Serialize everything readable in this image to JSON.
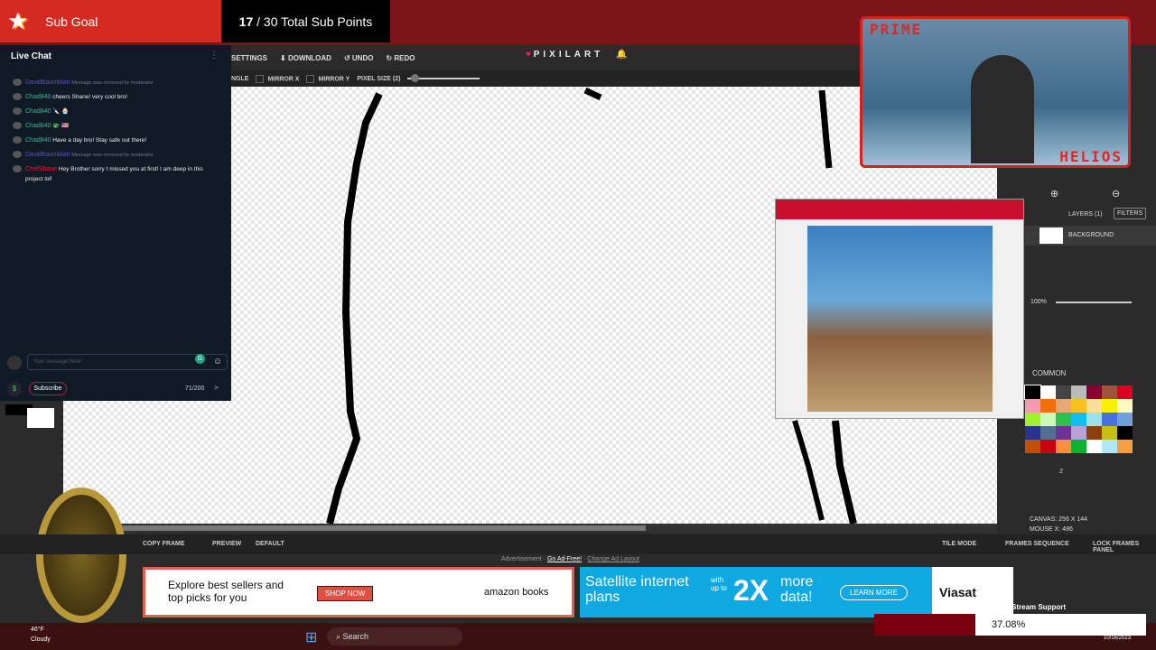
{
  "sub_goal": {
    "label": "Sub Goal",
    "current": "17",
    "total_text": "/ 30 Total Sub Points"
  },
  "toolbar": {
    "settings": "SETTINGS",
    "download": "DOWNLOAD",
    "undo": "UNDO",
    "redo": "REDO",
    "logo": "PIXILART",
    "angle": "NGLE",
    "mirror_x": "MIRROR X",
    "mirror_y": "MIRROR Y",
    "pixel_size": "PIXEL SIZE (2)"
  },
  "chat": {
    "title": "Live Chat",
    "messages": [
      {
        "user": "DavidBaumblatt",
        "text": "Message was removed by moderator",
        "color": "#5a4fc0"
      },
      {
        "user": "Chad840",
        "text": "cheers Shane! very cool bro!",
        "color": "#2fc090"
      },
      {
        "user": "Chad840",
        "text": "🔪 🧁",
        "color": "#2fc090"
      },
      {
        "user": "Chad840",
        "text": "🐲 🇺🇸",
        "color": "#2fc090"
      },
      {
        "user": "Chad840",
        "text": "Have a day bro! Stay safe out there!",
        "color": "#2fc090"
      },
      {
        "user": "DavidBaumblatt",
        "text": "Message was removed by moderator",
        "color": "#5a4fc0"
      },
      {
        "user": "ChefShane",
        "text": "Hey Brother sorry I missed you at first! I am deep in this project lol!",
        "color": "#e02030"
      }
    ],
    "placeholder": "Your message here!",
    "subscribe": "Subscribe",
    "count": "71/200"
  },
  "webcam": {
    "top_text": "PRIME",
    "bottom_text": "HELIOS"
  },
  "layers": {
    "title": "LAYERS (1)",
    "filters": "FILTERS",
    "layer_name": "BACKGROUND",
    "opacity": "100%"
  },
  "palette": {
    "name": "COMMON",
    "brush_size": "2",
    "colors": [
      "#000000",
      "#ffffff",
      "#444444",
      "#bbbbbb",
      "#8b0033",
      "#a0523c",
      "#dd0022",
      "#f49ab0",
      "#f07010",
      "#e8a878",
      "#f8c020",
      "#f8e098",
      "#f8f000",
      "#fff8c0",
      "#a0f030",
      "#d0f8b8",
      "#30c050",
      "#10c0e8",
      "#a0e0e8",
      "#4870e0",
      "#70a0d8",
      "#283090",
      "#507090",
      "#703098",
      "#b8a0d8",
      "#8b4008",
      "#c8c010",
      "#000000",
      "#c05008",
      "#c80010",
      "#f89040",
      "#10b030",
      "#ffffff",
      "#b0e8f8",
      "#f8a040"
    ]
  },
  "status": {
    "canvas": "CANVAS: 256 X 144",
    "mouse": "MOUSE X: 486"
  },
  "bottom": {
    "copy_frame": "COPY FRAME",
    "preview": "PREVIEW",
    "default": "DEFAULT",
    "tile_mode": "TILE MODE",
    "frames_sequence": "FRAMES SEQUENCE",
    "lock_frames": "LOCK FRAMES PANEL"
  },
  "ads": {
    "label": "Advertisement ·",
    "go_ad_free": "Go Ad-Free!",
    "change_layout": "Change Ad Layout",
    "amazon_text": "Explore best sellers and top picks for you",
    "shop_now": "SHOP NOW",
    "amazon_brand": "amazon books",
    "viasat_text": "Satellite internet plans",
    "with_up_to": "with up to",
    "big": "2X",
    "more_data": "more data!",
    "learn_more": "LEARN MORE",
    "viasat": "Viasat"
  },
  "overlay": {
    "stream_support": "Stream Support",
    "percent": "37.08%"
  },
  "taskbar": {
    "temp": "46°F",
    "weather": "Cloudy",
    "search": "Search",
    "date": "10/16/2023"
  }
}
